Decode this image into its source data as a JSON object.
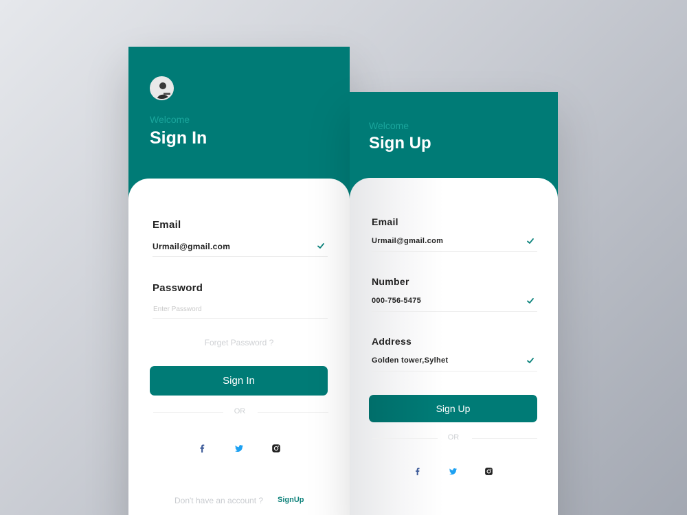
{
  "signin": {
    "welcome": "Welcome",
    "title": "Sign In",
    "email_label": "Email",
    "email_value": "Urmail@gmail.com",
    "password_label": "Password",
    "password_placeholder": "Enter Password",
    "forgot": "Forget Password ?",
    "button": "Sign In",
    "or": "OR",
    "no_account": "Don't have an account ?",
    "signup_link": "SignUp"
  },
  "signup": {
    "welcome": "Welcome",
    "title": "Sign Up",
    "email_label": "Email",
    "email_value": "Urmail@gmail.com",
    "number_label": "Number",
    "number_value": "000-756-5475",
    "address_label": "Address",
    "address_value": "Golden tower,Sylhet",
    "button": "Sign Up",
    "or": "OR"
  },
  "icons": [
    "facebook-icon",
    "twitter-icon",
    "instagram-icon",
    "check-icon"
  ],
  "colors": {
    "primary": "#007b76",
    "welcome_text": "#1aa59c",
    "facebook": "#3b5998",
    "twitter": "#1da1f2",
    "instagram": "#222222"
  }
}
